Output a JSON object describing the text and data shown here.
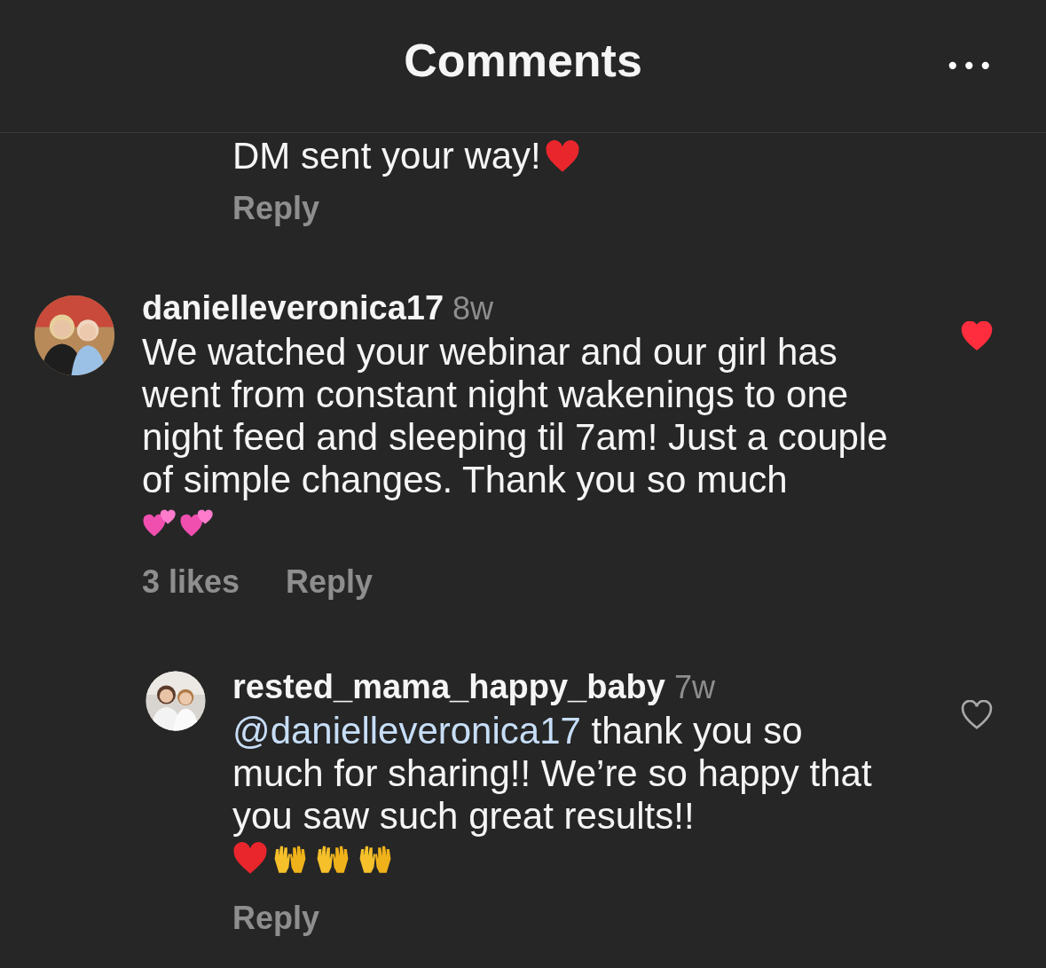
{
  "header": {
    "title": "Comments",
    "menu": "•••"
  },
  "partial_comment": {
    "text": "DM sent your way!",
    "emoji": [
      {
        "kind": "red-heart"
      }
    ],
    "reply": "Reply"
  },
  "comments": [
    {
      "username": "danielleveronica17",
      "time": "8w",
      "text": "We watched your webinar and our girl has went from constant night wakenings to one night feed and sleeping til 7am! Just a couple of simple changes. Thank you so much",
      "emoji": [
        {
          "kind": "two-hearts"
        },
        {
          "kind": "two-hearts"
        }
      ],
      "liked": true,
      "likes": "3 likes",
      "reply": "Reply",
      "children": [
        {
          "username": "rested_mama_happy_baby",
          "time": "7w",
          "mention": "@danielleveronica17",
          "text": " thank you so much for sharing!! We’re so happy that you saw such great results!!",
          "emoji": [
            {
              "kind": "red-heart"
            },
            {
              "kind": "raised-hands"
            },
            {
              "kind": "raised-hands"
            },
            {
              "kind": "raised-hands"
            }
          ],
          "liked": false,
          "reply": "Reply"
        }
      ]
    }
  ]
}
